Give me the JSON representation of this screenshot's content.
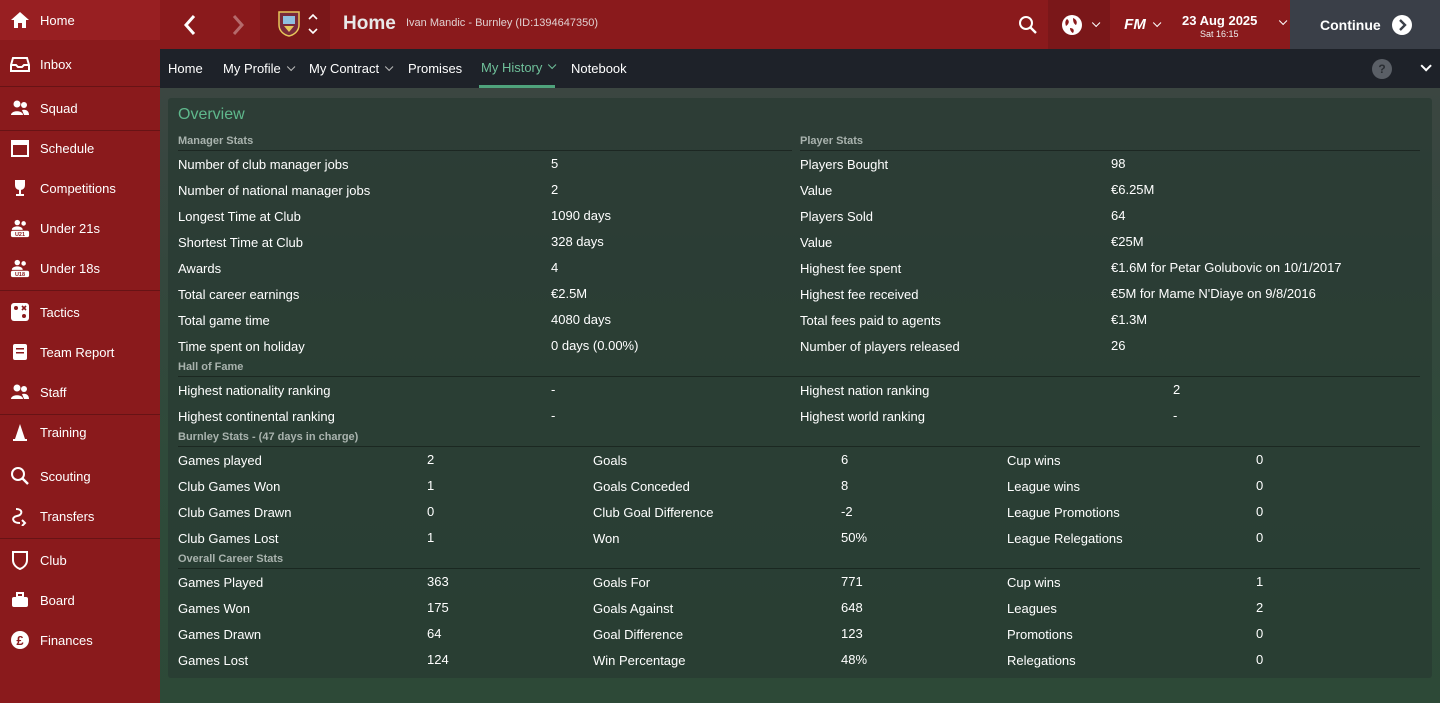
{
  "sidebar": {
    "items": [
      {
        "label": "Home",
        "icon": "home-icon"
      },
      {
        "label": "Inbox",
        "icon": "inbox-icon"
      },
      {
        "label": "Squad",
        "icon": "squad-icon"
      },
      {
        "label": "Schedule",
        "icon": "calendar-icon"
      },
      {
        "label": "Competitions",
        "icon": "trophy-icon"
      },
      {
        "label": "Under 21s",
        "icon": "u21-icon"
      },
      {
        "label": "Under 18s",
        "icon": "u18-icon"
      },
      {
        "label": "Tactics",
        "icon": "tactics-icon"
      },
      {
        "label": "Team Report",
        "icon": "report-icon"
      },
      {
        "label": "Staff",
        "icon": "staff-icon"
      },
      {
        "label": "Training",
        "icon": "training-icon"
      },
      {
        "label": "Scouting",
        "icon": "search-icon"
      },
      {
        "label": "Transfers",
        "icon": "transfers-icon"
      },
      {
        "label": "Club",
        "icon": "shield-icon"
      },
      {
        "label": "Board",
        "icon": "board-icon"
      },
      {
        "label": "Finances",
        "icon": "pound-icon"
      }
    ],
    "u21_badge": "U21",
    "u18_badge": "U18"
  },
  "header": {
    "title": "Home",
    "subtitle": "Ivan Mandic - Burnley (ID:1394647350)",
    "fm_logo": "FM",
    "date": "23 Aug 2025",
    "time": "Sat 16:15",
    "continue_label": "Continue"
  },
  "tabs": [
    {
      "label": "Home",
      "dropdown": false
    },
    {
      "label": "My Profile",
      "dropdown": true
    },
    {
      "label": "My Contract",
      "dropdown": true
    },
    {
      "label": "Promises",
      "dropdown": false
    },
    {
      "label": "My History",
      "dropdown": true
    },
    {
      "label": "Notebook",
      "dropdown": false
    }
  ],
  "help_label": "?",
  "overview": {
    "title": "Overview",
    "manager_stats": {
      "heading": "Manager Stats",
      "rows": [
        {
          "label": "Number of club manager jobs",
          "value": "5"
        },
        {
          "label": "Number of national manager jobs",
          "value": "2"
        },
        {
          "label": "Longest Time at Club",
          "value": "1090 days"
        },
        {
          "label": "Shortest Time at Club",
          "value": "328 days"
        },
        {
          "label": "Awards",
          "value": "4"
        },
        {
          "label": "Total career earnings",
          "value": "€2.5M"
        },
        {
          "label": "Total game time",
          "value": "4080 days"
        },
        {
          "label": "Time spent on holiday",
          "value": "0 days (0.00%)"
        }
      ]
    },
    "player_stats": {
      "heading": "Player Stats",
      "rows": [
        {
          "label": "Players Bought",
          "value": "98"
        },
        {
          "label": "Value",
          "value": "€6.25M"
        },
        {
          "label": "Players Sold",
          "value": "64"
        },
        {
          "label": "Value",
          "value": "€25M"
        },
        {
          "label": "Highest fee spent",
          "value": "€1.6M for Petar Golubovic on 10/1/2017"
        },
        {
          "label": "Highest fee received",
          "value": "€5M for Mame N'Diaye on 9/8/2016"
        },
        {
          "label": "Total fees paid to agents",
          "value": "€1.3M"
        },
        {
          "label": "Number of players released",
          "value": "26"
        }
      ]
    },
    "hall_of_fame": {
      "heading": "Hall of Fame",
      "rows": [
        {
          "label": "Highest nationality ranking",
          "value": "-",
          "label2": "Highest nation ranking",
          "value2": "2"
        },
        {
          "label": "Highest continental ranking",
          "value": "-",
          "label2": "Highest world ranking",
          "value2": "-"
        }
      ]
    },
    "club_stats": {
      "heading": "Burnley Stats - (47 days in charge)",
      "rows": [
        [
          {
            "label": "Games played",
            "value": "2"
          },
          {
            "label": "Goals",
            "value": "6"
          },
          {
            "label": "Cup wins",
            "value": "0"
          }
        ],
        [
          {
            "label": "Club Games Won",
            "value": "1"
          },
          {
            "label": "Goals Conceded",
            "value": "8"
          },
          {
            "label": "League wins",
            "value": "0"
          }
        ],
        [
          {
            "label": "Club Games Drawn",
            "value": "0"
          },
          {
            "label": "Club Goal Difference",
            "value": "-2"
          },
          {
            "label": "League Promotions",
            "value": "0"
          }
        ],
        [
          {
            "label": "Club Games Lost",
            "value": "1"
          },
          {
            "label": "Won",
            "value": "50%"
          },
          {
            "label": "League Relegations",
            "value": "0"
          }
        ]
      ]
    },
    "career_stats": {
      "heading": "Overall Career Stats",
      "rows": [
        [
          {
            "label": "Games Played",
            "value": "363"
          },
          {
            "label": "Goals For",
            "value": "771"
          },
          {
            "label": "Cup wins",
            "value": "1"
          }
        ],
        [
          {
            "label": "Games Won",
            "value": "175"
          },
          {
            "label": "Goals Against",
            "value": "648"
          },
          {
            "label": "Leagues",
            "value": "2"
          }
        ],
        [
          {
            "label": "Games Drawn",
            "value": "64"
          },
          {
            "label": "Goal Difference",
            "value": "123"
          },
          {
            "label": "Promotions",
            "value": "0"
          }
        ],
        [
          {
            "label": "Games Lost",
            "value": "124"
          },
          {
            "label": "Win Percentage",
            "value": "48%"
          },
          {
            "label": "Relegations",
            "value": "0"
          }
        ]
      ]
    }
  },
  "colors": {
    "sidebar": "#8a1a1c",
    "accent_green": "#5fb88c",
    "subnav": "#1e2229"
  }
}
